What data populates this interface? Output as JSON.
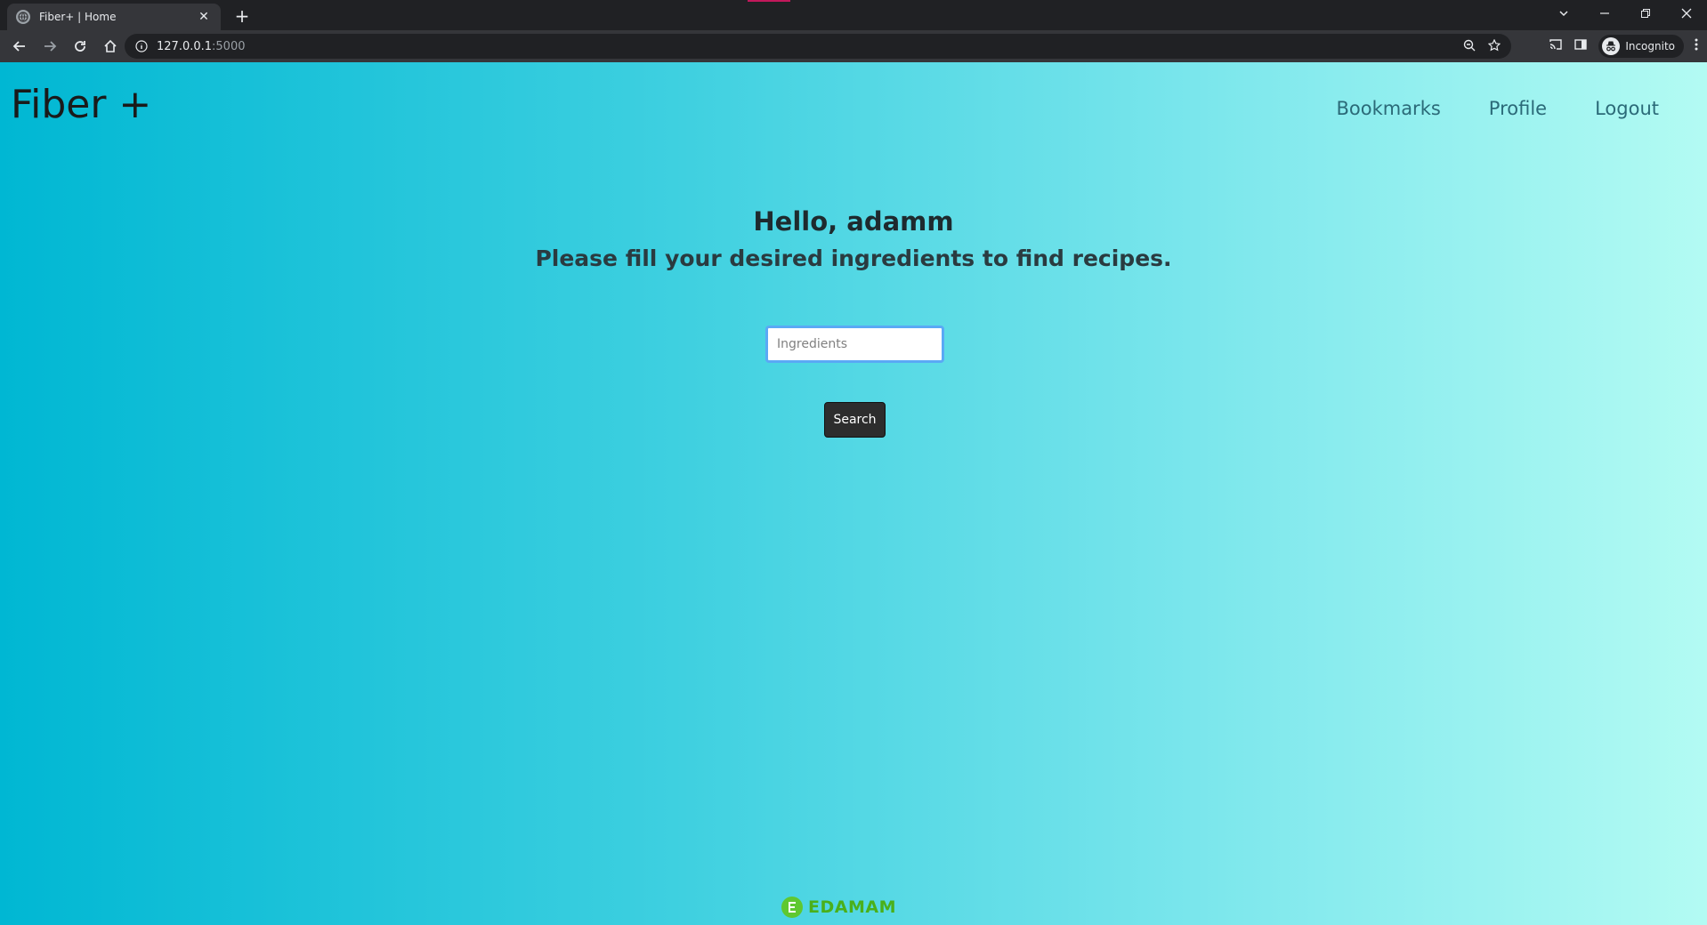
{
  "browser": {
    "tab_title": "Fiber+ | Home",
    "url_host": "127.0.0.1",
    "url_port": ":5000",
    "incognito_label": "Incognito"
  },
  "site": {
    "brand": "Fiber +",
    "nav": [
      "Bookmarks",
      "Profile",
      "Logout"
    ]
  },
  "main": {
    "greeting": "Hello, adamm",
    "subtitle": "Please fill your desired ingredients to find recipes.",
    "input_placeholder": "Ingredients",
    "search_label": "Search"
  },
  "footer": {
    "edamam_label": "EDAMAM"
  }
}
